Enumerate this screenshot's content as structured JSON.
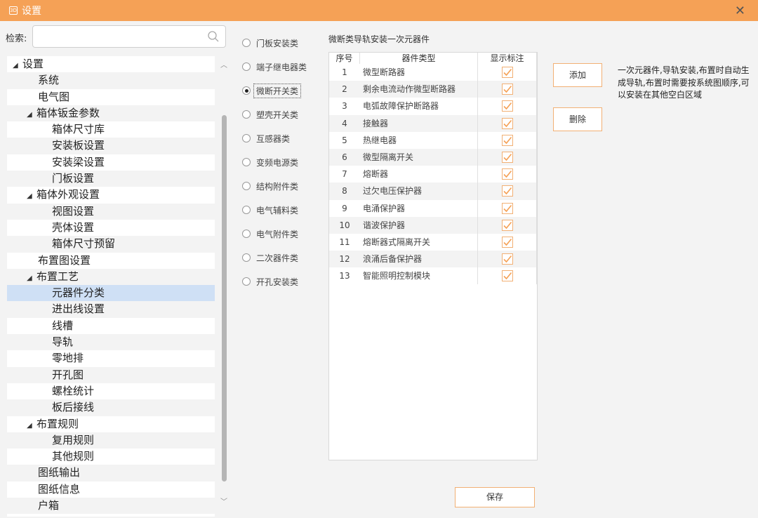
{
  "window": {
    "title": "设置",
    "close_glyph": "✕",
    "app_icon_text": "3D"
  },
  "search": {
    "label": "检索:",
    "value": "",
    "placeholder": ""
  },
  "tree": [
    {
      "label": "设置",
      "level": 0,
      "expanded": true
    },
    {
      "label": "系统",
      "level": 1
    },
    {
      "label": "电气图",
      "level": 1
    },
    {
      "label": "箱体钣金参数",
      "level": 1,
      "expanded": true
    },
    {
      "label": "箱体尺寸库",
      "level": 2
    },
    {
      "label": "安装板设置",
      "level": 2
    },
    {
      "label": "安装梁设置",
      "level": 2
    },
    {
      "label": "门板设置",
      "level": 2
    },
    {
      "label": "箱体外观设置",
      "level": 1,
      "expanded": true
    },
    {
      "label": "视图设置",
      "level": 2
    },
    {
      "label": "壳体设置",
      "level": 2
    },
    {
      "label": "箱体尺寸预留",
      "level": 2
    },
    {
      "label": "布置图设置",
      "level": 1
    },
    {
      "label": "布置工艺",
      "level": 1,
      "expanded": true
    },
    {
      "label": "元器件分类",
      "level": 2,
      "selected": true
    },
    {
      "label": "进出线设置",
      "level": 2
    },
    {
      "label": "线槽",
      "level": 2
    },
    {
      "label": "导轨",
      "level": 2
    },
    {
      "label": "零地排",
      "level": 2
    },
    {
      "label": "开孔图",
      "level": 2
    },
    {
      "label": "螺栓统计",
      "level": 2
    },
    {
      "label": "板后接线",
      "level": 2
    },
    {
      "label": "布置规则",
      "level": 1,
      "expanded": true
    },
    {
      "label": "复用规则",
      "level": 2
    },
    {
      "label": "其他规则",
      "level": 2
    },
    {
      "label": "图纸输出",
      "level": 1
    },
    {
      "label": "图纸信息",
      "level": 1
    },
    {
      "label": "户箱",
      "level": 1
    }
  ],
  "categories": [
    {
      "label": "门板安装类",
      "checked": false
    },
    {
      "label": "端子继电器类",
      "checked": false
    },
    {
      "label": "微断开关类",
      "checked": true
    },
    {
      "label": "塑壳开关类",
      "checked": false
    },
    {
      "label": "互感器类",
      "checked": false
    },
    {
      "label": "变频电源类",
      "checked": false
    },
    {
      "label": "结构附件类",
      "checked": false
    },
    {
      "label": "电气辅料类",
      "checked": false
    },
    {
      "label": "电气附件类",
      "checked": false
    },
    {
      "label": "二次器件类",
      "checked": false
    },
    {
      "label": "开孔安装类",
      "checked": false
    }
  ],
  "group_title": "微断类导轨安装一次元器件",
  "table": {
    "headers": {
      "index": "序号",
      "type": "器件类型",
      "show_label": "显示标注"
    },
    "rows": [
      {
        "index": "1",
        "type": "微型断路器",
        "checked": true
      },
      {
        "index": "2",
        "type": "剩余电流动作微型断路器",
        "checked": true
      },
      {
        "index": "3",
        "type": "电弧故障保护断路器",
        "checked": true
      },
      {
        "index": "4",
        "type": "接触器",
        "checked": true
      },
      {
        "index": "5",
        "type": "热继电器",
        "checked": true
      },
      {
        "index": "6",
        "type": "微型隔离开关",
        "checked": true
      },
      {
        "index": "7",
        "type": "熔断器",
        "checked": true
      },
      {
        "index": "8",
        "type": "过欠电压保护器",
        "checked": true
      },
      {
        "index": "9",
        "type": "电涌保护器",
        "checked": true
      },
      {
        "index": "10",
        "type": "谐波保护器",
        "checked": true
      },
      {
        "index": "11",
        "type": "熔断器式隔离开关",
        "checked": true
      },
      {
        "index": "12",
        "type": "浪涌后备保护器",
        "checked": true
      },
      {
        "index": "13",
        "type": "智能照明控制模块",
        "checked": true
      }
    ]
  },
  "buttons": {
    "add": "添加",
    "delete": "删除",
    "save": "保存"
  },
  "description": "一次元器件,导轨安装,布置时自动生成导轨,布置时需要按系统图顺序,可以安装在其他空白区域",
  "colors": {
    "titlebar": "#f5a156",
    "accent_border": "#f2b074",
    "check": "#f5a156",
    "selection": "#cfe0f5"
  }
}
